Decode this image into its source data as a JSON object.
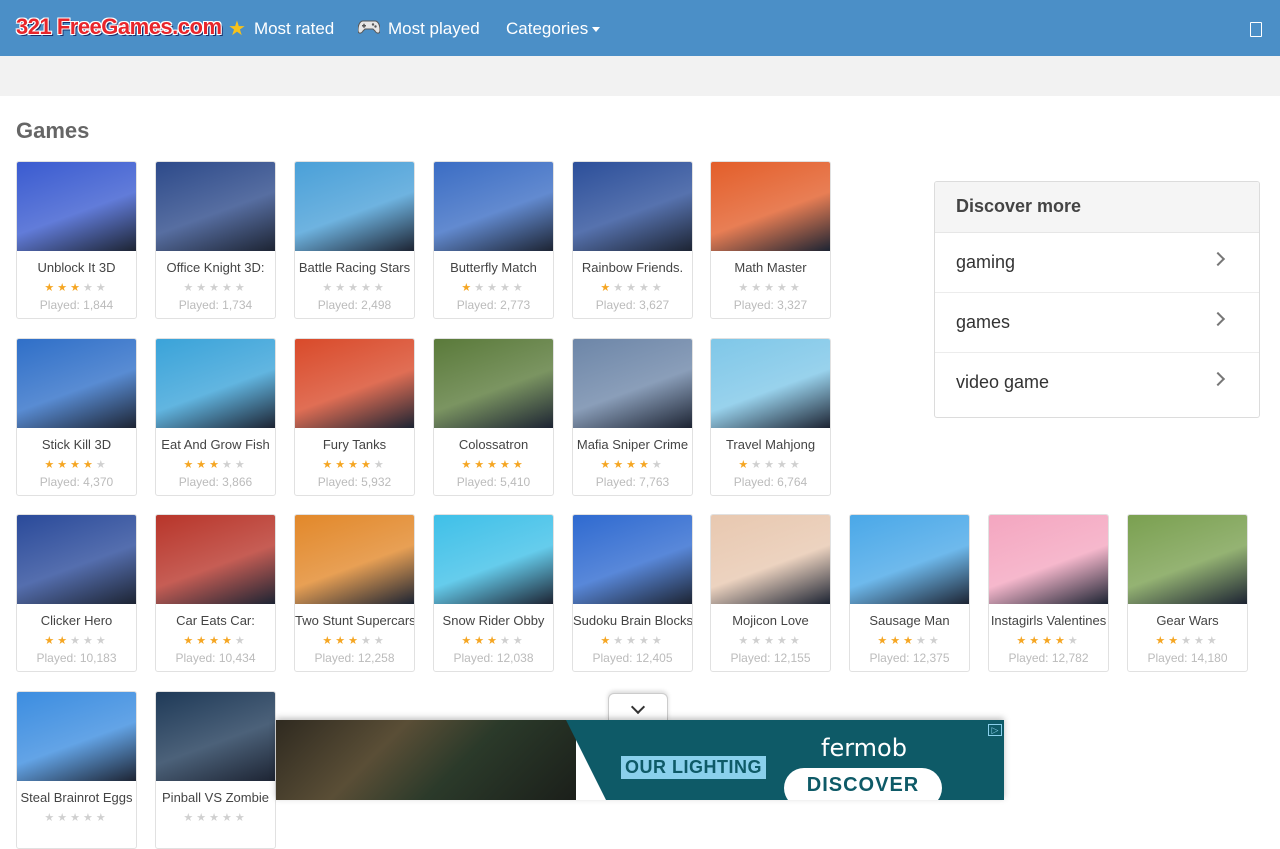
{
  "navbar": {
    "logo": "321 FreeGames.com",
    "most_rated": {
      "icon": "star-icon",
      "label": "Most rated"
    },
    "most_played": {
      "icon": "gamepad-icon",
      "label": "Most played"
    },
    "categories": {
      "label": "Categories"
    }
  },
  "section_title": "Games",
  "games": [
    {
      "name": "Unblock It 3D",
      "stars": 3,
      "played": "Played: 1,844",
      "color": "#3a5bd0"
    },
    {
      "name": "Office Knight 3D:",
      "stars": 0,
      "played": "Played: 1,734",
      "color": "#2d4a8a"
    },
    {
      "name": "Battle Racing Stars",
      "stars": 0,
      "played": "Played: 2,498",
      "color": "#4aa0d8"
    },
    {
      "name": "Butterfly Match",
      "stars": 1,
      "played": "Played: 2,773",
      "color": "#3b6dc4"
    },
    {
      "name": "Rainbow Friends.",
      "stars": 1,
      "played": "Played: 3,627",
      "color": "#2c4f9a"
    },
    {
      "name": "Math Master",
      "stars": 0,
      "played": "Played: 3,327",
      "color": "#e35e2a"
    },
    {
      "name": "Stick Kill 3D",
      "stars": 4,
      "played": "Played: 4,370",
      "color": "#2f6fc8"
    },
    {
      "name": "Eat And Grow Fish",
      "stars": 3,
      "played": "Played: 3,866",
      "color": "#3aa3d9"
    },
    {
      "name": "Fury Tanks",
      "stars": 3.5,
      "played": "Played: 5,932",
      "color": "#d94a2a"
    },
    {
      "name": "Colossatron",
      "stars": 4.5,
      "played": "Played: 5,410",
      "color": "#5a7a3a"
    },
    {
      "name": "Mafia Sniper Crime",
      "stars": 4,
      "played": "Played: 7,763",
      "color": "#6d86a8"
    },
    {
      "name": "Travel Mahjong",
      "stars": 1,
      "played": "Played: 6,764",
      "color": "#7fc7e8"
    },
    {
      "name": "Clicker Hero",
      "stars": 2,
      "played": "Played: 10,183",
      "color": "#2a4a9a"
    },
    {
      "name": "Car Eats Car:",
      "stars": 4,
      "played": "Played: 10,434",
      "color": "#b8352a"
    },
    {
      "name": "Two Stunt Supercars",
      "stars": 3,
      "played": "Played: 12,258",
      "color": "#e2882a"
    },
    {
      "name": "Snow Rider Obby",
      "stars": 3,
      "played": "Played: 12,038",
      "color": "#3fc0e8"
    },
    {
      "name": "Sudoku Brain Blocks",
      "stars": 1,
      "played": "Played: 12,405",
      "color": "#2f6ad0"
    },
    {
      "name": "Mojicon Love",
      "stars": 0,
      "played": "Played: 12,155",
      "color": "#e8c8b0"
    },
    {
      "name": "Sausage Man",
      "stars": 3,
      "played": "Played: 12,375",
      "color": "#4aa8e8"
    },
    {
      "name": "Instagirls Valentines",
      "stars": 4,
      "played": "Played: 12,782",
      "color": "#f4a6c0"
    },
    {
      "name": "Gear Wars",
      "stars": 2,
      "played": "Played: 14,180",
      "color": "#7aa050"
    },
    {
      "name": "Steal Brainrot Eggs",
      "stars": 0,
      "played": "",
      "color": "#3c8de0"
    },
    {
      "name": "Pinball VS Zombie",
      "stars": 0,
      "played": "",
      "color": "#1f3a58"
    }
  ],
  "discover": {
    "title": "Discover more",
    "items": [
      "gaming",
      "games",
      "video game"
    ]
  },
  "ad": {
    "headline": "OUR LIGHTING",
    "brand": "fermob",
    "cta": "DISCOVER"
  }
}
